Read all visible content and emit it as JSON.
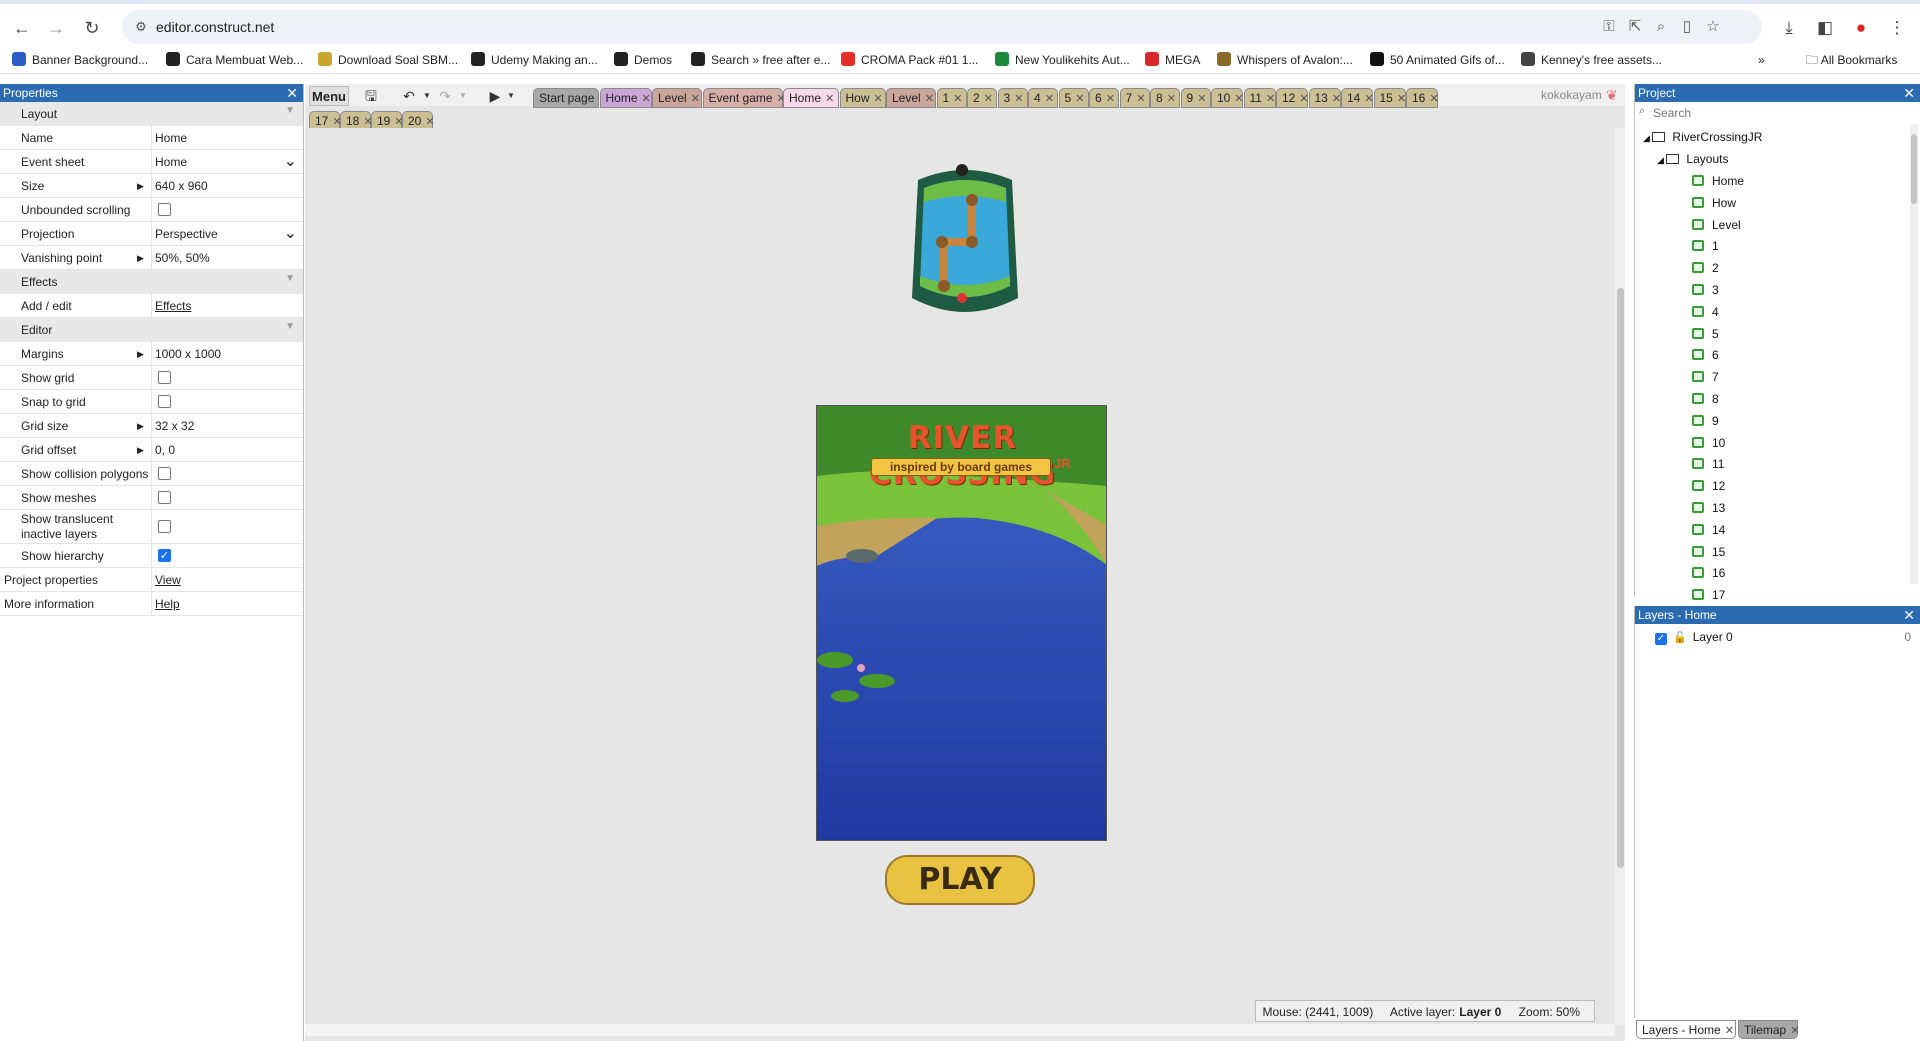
{
  "browser": {
    "url": "editor.construct.net",
    "bookmarks": [
      {
        "label": "Banner Background...",
        "color": "#2f5dc7"
      },
      {
        "label": "Cara Membuat Web...",
        "color": "#222"
      },
      {
        "label": "Download Soal SBM...",
        "color": "#c7a52f"
      },
      {
        "label": "Udemy Making an...",
        "color": "#222"
      },
      {
        "label": "Demos",
        "color": "#222"
      },
      {
        "label": "Search » free after e...",
        "color": "#222"
      },
      {
        "label": "CROMA Pack #01 1...",
        "color": "#e52d27"
      },
      {
        "label": "New Youlikehits Aut...",
        "color": "#1a8a3a"
      },
      {
        "label": "MEGA",
        "color": "#d9272e"
      },
      {
        "label": "Whispers of Avalon:...",
        "color": "#8a6a2a"
      },
      {
        "label": "50 Animated Gifs of...",
        "color": "#111"
      },
      {
        "label": "Kenney's free assets...",
        "color": "#444"
      }
    ],
    "all_bookmarks": "All Bookmarks"
  },
  "properties": {
    "title": "Properties",
    "rows": [
      {
        "type": "section",
        "label": "Layout"
      },
      {
        "label": "Name",
        "value": "Home"
      },
      {
        "label": "Event sheet",
        "value": "Home",
        "dropdown": true
      },
      {
        "label": "Size",
        "value": "640 x 960",
        "expand": true
      },
      {
        "label": "Unbounded scrolling",
        "checkbox": false
      },
      {
        "label": "Projection",
        "value": "Perspective",
        "dropdown": true
      },
      {
        "label": "Vanishing point",
        "value": "50%, 50%",
        "expand": true
      },
      {
        "type": "section",
        "label": "Effects"
      },
      {
        "label": "Add / edit",
        "link": "Effects"
      },
      {
        "type": "section",
        "label": "Editor"
      },
      {
        "label": "Margins",
        "value": "1000 x 1000",
        "expand": true
      },
      {
        "label": "Show grid",
        "checkbox": false
      },
      {
        "label": "Snap to grid",
        "checkbox": false
      },
      {
        "label": "Grid size",
        "value": "32 x 32",
        "expand": true
      },
      {
        "label": "Grid offset",
        "value": "0, 0",
        "expand": true
      },
      {
        "label": "Show collision polygons",
        "checkbox": false
      },
      {
        "label": "Show meshes",
        "checkbox": false
      },
      {
        "label": "Show translucent inactive layers",
        "checkbox": false,
        "tall": true
      },
      {
        "label": "Show hierarchy",
        "checkbox": true
      },
      {
        "label": "Project properties",
        "link": "View",
        "outer": true
      },
      {
        "label": "More information",
        "link": "Help",
        "outer": true
      }
    ]
  },
  "editor": {
    "menu_label": "Menu",
    "tabs_row1": [
      {
        "label": "Start page",
        "kind": "start"
      },
      {
        "label": "Home",
        "kind": "layout"
      },
      {
        "label": "Level",
        "kind": "level"
      },
      {
        "label": "Event game",
        "kind": "event"
      },
      {
        "label": "Home",
        "kind": "active"
      },
      {
        "label": "How",
        "kind": "num"
      },
      {
        "label": "Level",
        "kind": "level"
      },
      {
        "label": "1",
        "kind": "num"
      },
      {
        "label": "2",
        "kind": "num"
      },
      {
        "label": "3",
        "kind": "num"
      },
      {
        "label": "4",
        "kind": "num"
      },
      {
        "label": "5",
        "kind": "num"
      },
      {
        "label": "6",
        "kind": "num"
      },
      {
        "label": "7",
        "kind": "num"
      },
      {
        "label": "8",
        "kind": "num"
      },
      {
        "label": "9",
        "kind": "num"
      },
      {
        "label": "10",
        "kind": "num"
      },
      {
        "label": "11",
        "kind": "num"
      },
      {
        "label": "12",
        "kind": "num"
      },
      {
        "label": "13",
        "kind": "num"
      },
      {
        "label": "14",
        "kind": "num"
      },
      {
        "label": "15",
        "kind": "num"
      },
      {
        "label": "16",
        "kind": "num"
      }
    ],
    "tabs_row2": [
      "17",
      "18",
      "19",
      "20"
    ],
    "user": "kokokayam",
    "game": {
      "title": "RIVER CROSSING",
      "title_suffix": "JR",
      "subtitle": "inspired by board games",
      "play_label": "PLAY"
    },
    "status": {
      "mouse": "Mouse: (2441, 1009)",
      "active_layer_prefix": "Active layer:",
      "active_layer": "Layer 0",
      "zoom": "Zoom: 50%"
    }
  },
  "project": {
    "title": "Project",
    "search_placeholder": "Search",
    "root": "RiverCrossingJR",
    "folder": "Layouts",
    "layouts": [
      "Home",
      "How",
      "Level",
      "1",
      "2",
      "3",
      "4",
      "5",
      "6",
      "7",
      "8",
      "9",
      "10",
      "11",
      "12",
      "13",
      "14",
      "15",
      "16",
      "17"
    ]
  },
  "layers": {
    "title": "Layers - Home",
    "items": [
      {
        "name": "Layer 0",
        "count": "0"
      }
    ],
    "bottom_tabs": [
      "Layers - Home",
      "Tilemap"
    ]
  }
}
